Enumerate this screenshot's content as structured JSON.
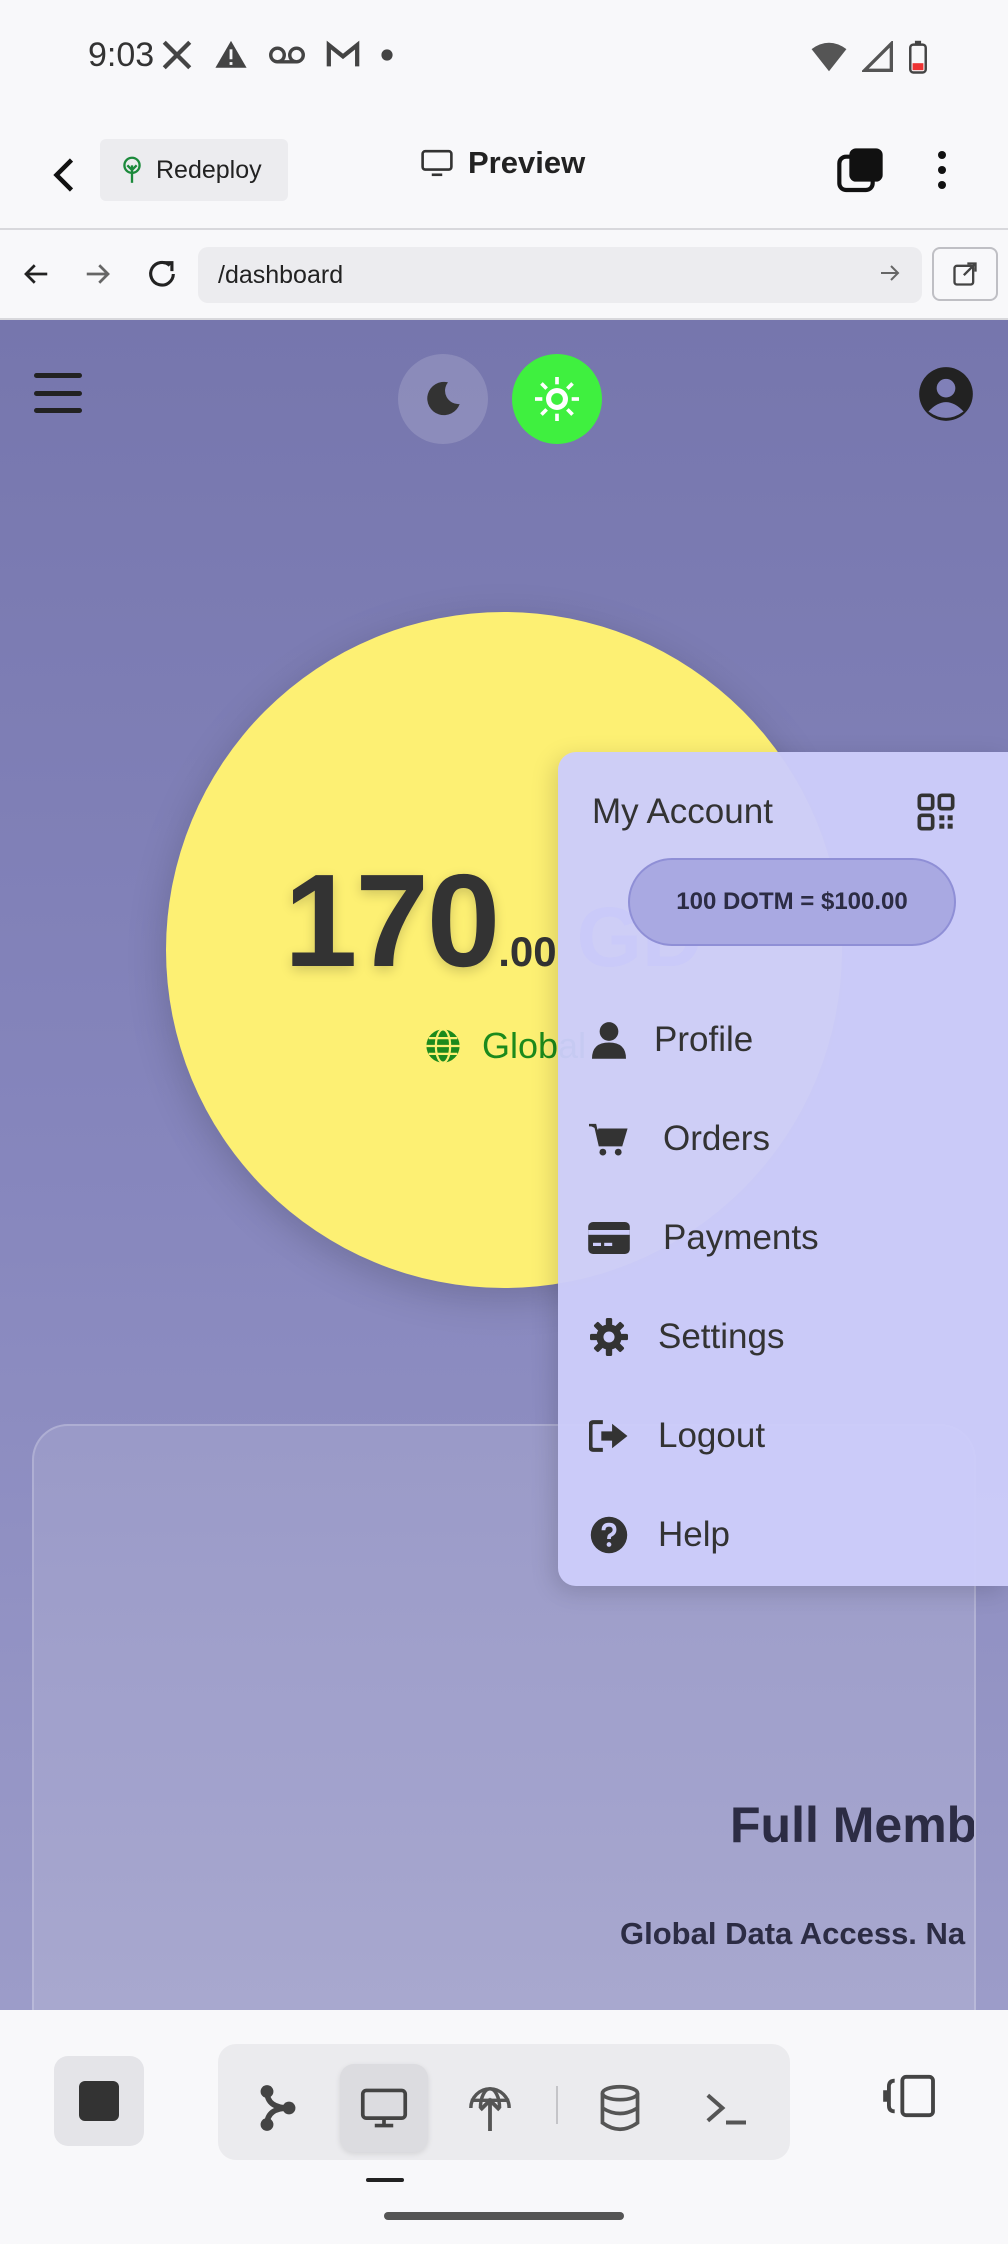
{
  "status_bar": {
    "time": "9:03"
  },
  "app_bar": {
    "redeploy_label": "Redeploy",
    "preview_label": "Preview"
  },
  "url_bar": {
    "url": "/dashboard"
  },
  "dashboard": {
    "balance_integer": "170",
    "balance_decimal": ".00",
    "balance_currency": "GD",
    "network_label": "Global",
    "card_title": "Full Memb",
    "card_subtitle": "Global Data Access. Na"
  },
  "account_menu": {
    "title": "My Account",
    "rate_label": "100 DOTM = $100.00",
    "items": [
      {
        "label": "Profile",
        "icon": "user-icon"
      },
      {
        "label": "Orders",
        "icon": "cart-icon"
      },
      {
        "label": "Payments",
        "icon": "credit-card-icon"
      },
      {
        "label": "Settings",
        "icon": "gear-icon"
      },
      {
        "label": "Logout",
        "icon": "logout-icon"
      },
      {
        "label": "Help",
        "icon": "help-icon"
      }
    ]
  },
  "colors": {
    "accent_green": "#3ff03f",
    "balance_circle": "#fdf073",
    "page_bg": "#7676ad",
    "menu_bg": "#ccccfa"
  }
}
